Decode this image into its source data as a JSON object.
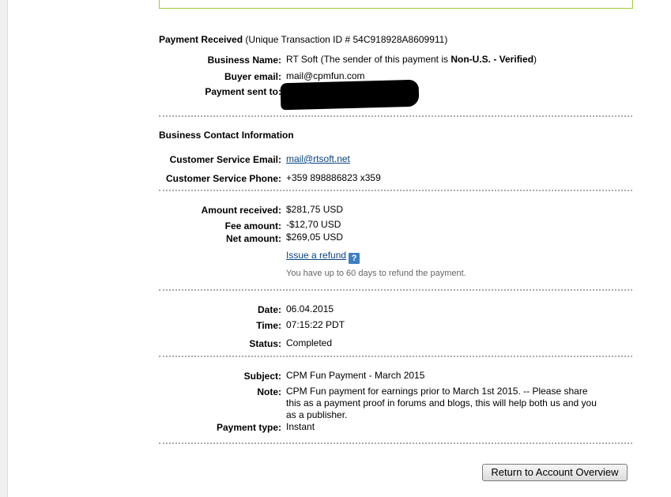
{
  "payment_header": {
    "title": "Payment Received",
    "transaction_id_text": "(Unique Transaction ID # 54C918928A8609911)"
  },
  "details": {
    "business_name_label": "Business Name:",
    "business_name_value": "RT Soft",
    "sender_note_pre": "(The sender of this payment is ",
    "sender_note_status": "Non-U.S. - Verified",
    "sender_note_post": ")",
    "buyer_email_label": "Buyer email:",
    "buyer_email_value": "mail@cpmfun.com",
    "payment_sent_to_label": "Payment sent to:"
  },
  "business_contact": {
    "heading": "Business Contact Information",
    "cs_email_label": "Customer Service Email:",
    "cs_email_value": "mail@rtsoft.net",
    "cs_phone_label": "Customer Service Phone:",
    "cs_phone_value": "+359 898886823 x359"
  },
  "amounts": {
    "amount_received_label": "Amount received:",
    "amount_received_value": "$281,75 USD",
    "fee_amount_label": "Fee amount:",
    "fee_amount_value": "-$12,70 USD",
    "net_amount_label": "Net amount:",
    "net_amount_value": "$269,05 USD",
    "issue_refund_link": "Issue a refund",
    "help_icon_glyph": "?",
    "refund_note": "You have up to 60 days to refund the payment."
  },
  "dates": {
    "date_label": "Date:",
    "date_value": "06.04.2015",
    "time_label": "Time:",
    "time_value": "07:15:22 PDT",
    "status_label": "Status:",
    "status_value": "Completed"
  },
  "subject_section": {
    "subject_label": "Subject:",
    "subject_value": "CPM Fun Payment - March 2015",
    "note_label": "Note:",
    "note_line1": "CPM Fun payment for earnings prior to March 1st 2015. -- Please share",
    "note_line2": "this as a payment proof in forums and blogs, this will help both us and you",
    "note_line3": "as a publisher.",
    "payment_type_label": "Payment type:",
    "payment_type_value": "Instant"
  },
  "actions": {
    "return_button": "Return to Account Overview"
  },
  "colors": {
    "link": "#084482",
    "separator": "#aaaaaa",
    "top_box_border": "#9acd32",
    "help_icon_bg": "#3d7fc1"
  }
}
